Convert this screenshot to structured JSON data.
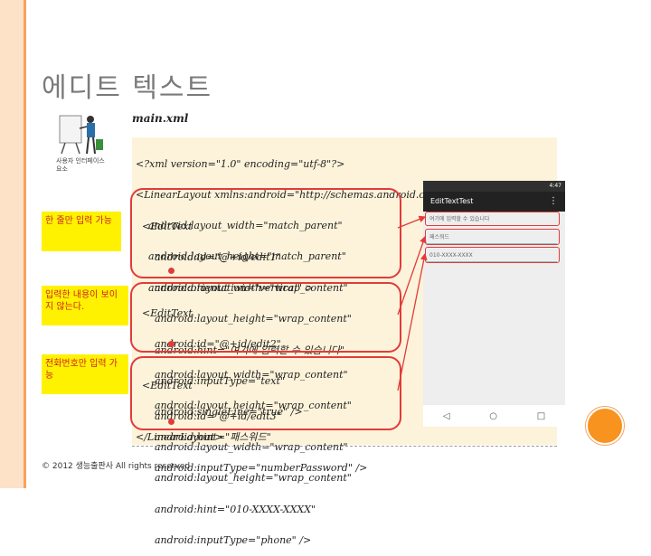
{
  "slide": {
    "title": "에디트 텍스트",
    "file_title": "main.xml",
    "author_caption": "사용자 인터페이스 요소",
    "footer": "© 2012 생능출판사  All rights reserved"
  },
  "code": {
    "header": [
      "<?xml version=\"1.0\" encoding=\"utf-8\"?>",
      "<LinearLayout xmlns:android=\"http://schemas.android.com/apk/res/android\"",
      "    android:layout_width=\"match_parent\"",
      "    android:layout_height=\"match_parent\"",
      "    android:orientation=\"vertical\" >"
    ],
    "block1": [
      "  <EditText",
      "      android:id=\"@+id/edit1\"",
      "      android:layout_width=\"wrap_content\"",
      "      android:layout_height=\"wrap_content\"",
      "      android:hint=\"여기에 입력할 수 있습니다\"",
      "      android:inputType=\"text\"",
      "      android:singleLine=\"true\" />"
    ],
    "block2": [
      "  <EditText",
      "      android:id=\"@+id/edit2\"",
      "      android:layout_width=\"wrap_content\"",
      "      android:layout_height=\"wrap_content\"",
      "      android:hint=\"패스워드\"",
      "      android:inputType=\"numberPassword\" />"
    ],
    "block3": [
      "  <EditText",
      "      android:id=\"@+id/edit3\"",
      "      android:layout_width=\"wrap_content\"",
      "      android:layout_height=\"wrap_content\"",
      "      android:hint=\"010-XXXX-XXXX\"",
      "      android:inputType=\"phone\" />"
    ],
    "footer": "</LinearLayout>"
  },
  "notes": [
    "한 줄만 입력 가능",
    "입력한 내용이 보이지 않는다.",
    "전화번호만 입력 가능"
  ],
  "phone": {
    "status_time": "4:47",
    "app_title": "EditTextTest",
    "fields": [
      "여기에 입력할 수 있습니다",
      "패스워드",
      "010-XXXX-XXXX"
    ],
    "nav": [
      "◁",
      "○",
      "□"
    ]
  },
  "colors": {
    "accent": "#f6a35c",
    "highlight": "#e23b3b",
    "note_bg": "#fff200"
  }
}
